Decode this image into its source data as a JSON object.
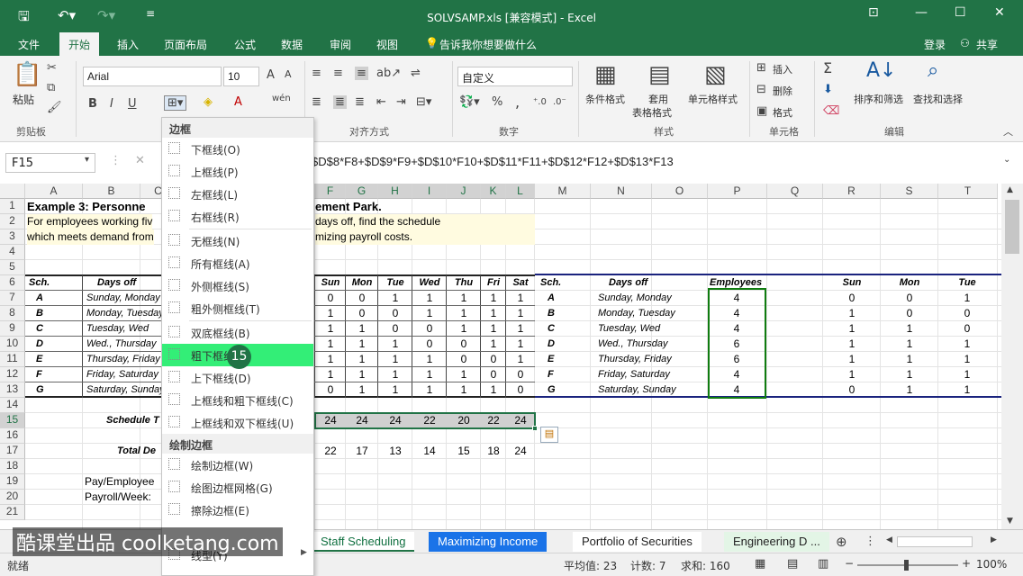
{
  "window": {
    "title": "SOLVSAMP.xls  [兼容模式] - Excel"
  },
  "tabs": [
    "文件",
    "开始",
    "插入",
    "页面布局",
    "公式",
    "数据",
    "审阅",
    "视图"
  ],
  "tell_me": "告诉我你想要做什么",
  "account": {
    "login": "登录",
    "share": "共享"
  },
  "ribbon": {
    "clipboard": {
      "paste": "粘贴",
      "label": "剪贴板"
    },
    "font": {
      "name": "Arial",
      "size": "10",
      "bold": "B",
      "italic": "I",
      "underline": "U",
      "wen": "wén"
    },
    "alignment": {
      "label": "对齐方式"
    },
    "number": {
      "format": "自定义",
      "label": "数字",
      "percent": "%",
      "comma": ","
    },
    "styles": {
      "cond": "条件格式",
      "table": "套用",
      "table2": "表格格式",
      "cell": "单元格样式",
      "label": "样式"
    },
    "cells": {
      "insert": "插入",
      "delete": "删除",
      "format": "格式",
      "label": "单元格"
    },
    "editing": {
      "sort": "排序和筛选",
      "find": "查找和选择",
      "label": "编辑",
      "sigma": "Σ"
    }
  },
  "formula_bar": {
    "name_box": "F15",
    "formula": "$D$8*F8+$D$9*F9+$D$10*F10+$D$11*F11+$D$12*F12+$D$13*F13",
    "cancel": "✕"
  },
  "columns": [
    "A",
    "B",
    "C",
    "D",
    "E",
    "F",
    "G",
    "H",
    "I",
    "J",
    "K",
    "L",
    "M",
    "N",
    "O",
    "P",
    "Q",
    "R",
    "S",
    "T"
  ],
  "rows": [
    "1",
    "2",
    "3",
    "4",
    "5",
    "6",
    "7",
    "8",
    "9",
    "10",
    "11",
    "12",
    "13",
    "14",
    "15",
    "16",
    "17",
    "18",
    "19",
    "20",
    "21"
  ],
  "sheet": {
    "title": "Example 3:  Personne",
    "title_rest": "ement Park.",
    "desc1": "For employees working fiv",
    "desc1_rest": "days off, find the schedule",
    "desc2": "which meets demand from",
    "desc2_rest": "mizing payroll costs.",
    "hdr_sch": "Sch.",
    "hdr_days": "Days off",
    "days_hdr": [
      "Sun",
      "Mon",
      "Tue",
      "Wed",
      "Thu",
      "Fri",
      "Sat"
    ],
    "sch": [
      "A",
      "B",
      "C",
      "D",
      "E",
      "F",
      "G"
    ],
    "daysoff_left": [
      "Sunday, Monday",
      "Monday, Tuesday",
      "Tuesday, Wed",
      "Wed., Thursday",
      "Thursday, Friday",
      "Friday, Saturday",
      "Saturday, Sunday"
    ],
    "matrix": [
      [
        "0",
        "0",
        "1",
        "1",
        "1",
        "1",
        "1"
      ],
      [
        "1",
        "0",
        "0",
        "1",
        "1",
        "1",
        "1"
      ],
      [
        "1",
        "1",
        "0",
        "0",
        "1",
        "1",
        "1"
      ],
      [
        "1",
        "1",
        "1",
        "0",
        "0",
        "1",
        "1"
      ],
      [
        "1",
        "1",
        "1",
        "1",
        "0",
        "0",
        "1"
      ],
      [
        "1",
        "1",
        "1",
        "1",
        "1",
        "0",
        "0"
      ],
      [
        "0",
        "1",
        "1",
        "1",
        "1",
        "1",
        "0"
      ]
    ],
    "schedule_label": "Schedule T",
    "schedule_totals": [
      "24",
      "24",
      "24",
      "22",
      "20",
      "22",
      "24"
    ],
    "total_label": "Total De",
    "total_demand": [
      "22",
      "17",
      "13",
      "14",
      "15",
      "18",
      "24"
    ],
    "pay_label": "Pay/Employee",
    "payroll_label": "Payroll/Week:",
    "right_hdr_employees": "Employees",
    "right_days": [
      "Sunday, Monday",
      "Monday, Tuesday",
      "Tuesday, Wed",
      "Wed., Thursday",
      "Thursday, Friday",
      "Friday, Saturday",
      "Saturday, Sunday"
    ],
    "employees": [
      "4",
      "4",
      "4",
      "6",
      "6",
      "4",
      "4"
    ],
    "right_hdr_days": [
      "Sun",
      "Mon",
      "Tue"
    ],
    "right_matrix": [
      [
        "0",
        "0",
        "1"
      ],
      [
        "1",
        "0",
        "0"
      ],
      [
        "1",
        "1",
        "0"
      ],
      [
        "1",
        "1",
        "1"
      ],
      [
        "1",
        "1",
        "1"
      ],
      [
        "1",
        "1",
        "1"
      ],
      [
        "0",
        "1",
        "1"
      ]
    ]
  },
  "sheet_tabs": [
    "Staff Scheduling",
    "Maximizing Income",
    "Portfolio of Securities",
    "Engineering D ..."
  ],
  "status": {
    "ready": "就绪",
    "avg": "平均值: 23",
    "count": "计数: 7",
    "sum": "求和: 160",
    "zoom": "100%"
  },
  "border_menu": {
    "header1": "边框",
    "items1": [
      "下框线(O)",
      "上框线(P)",
      "左框线(L)",
      "右框线(R)"
    ],
    "items2": [
      "无框线(N)",
      "所有框线(A)",
      "外侧框线(S)",
      "粗外侧框线(T)"
    ],
    "items3": [
      "双底框线(B)",
      "粗下框线(H)",
      "上下框线(D)",
      "上框线和粗下框线(C)",
      "上框线和双下框线(U)"
    ],
    "header2": "绘制边框",
    "items4": [
      "绘制边框(W)",
      "绘图边框网格(G)",
      "擦除边框(E)"
    ],
    "line_style": "线型(Y)"
  },
  "badge": "15",
  "watermark": "酷课堂出品 coolketang.com",
  "colors": {
    "excel_green": "#217346",
    "highlight": "#33ee77",
    "blue_tab": "#1a73e8"
  }
}
